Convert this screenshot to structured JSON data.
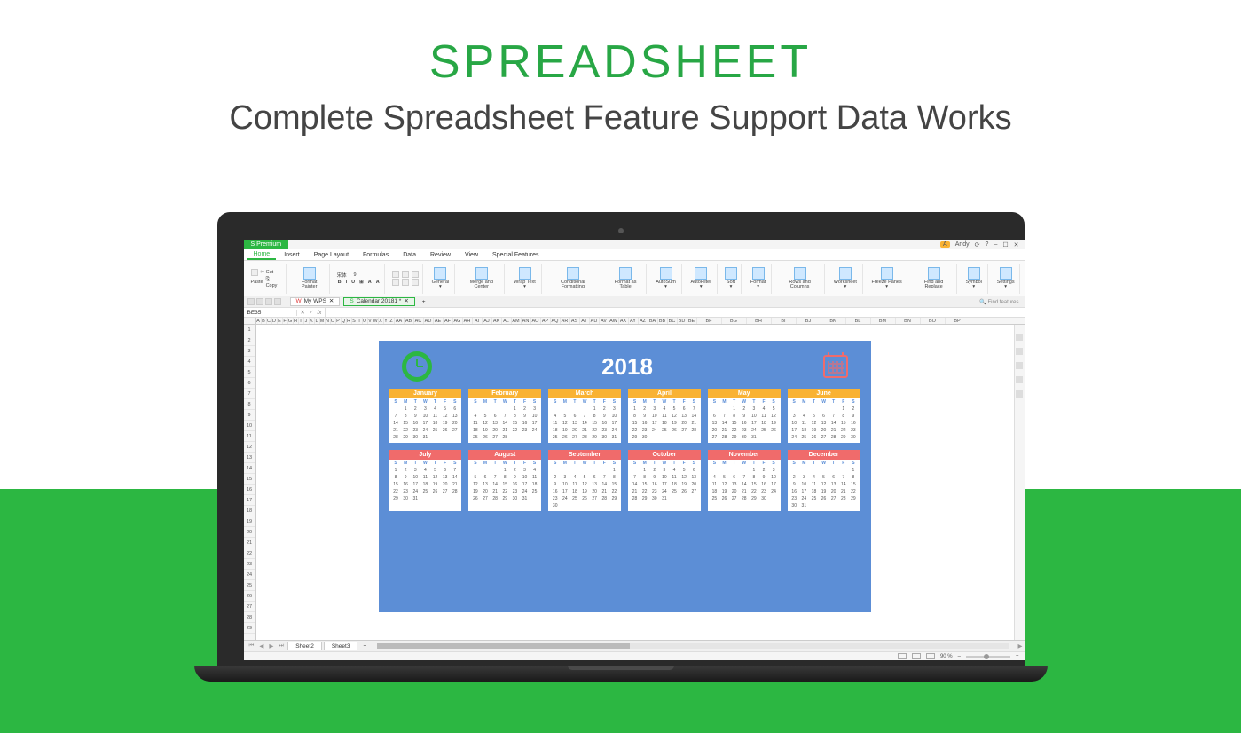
{
  "hero": {
    "title": "SPREADSHEET",
    "subtitle": "Complete Spreadsheet Feature Support Data Works"
  },
  "titlebar": {
    "premium": "S Premium",
    "user": "Andy",
    "icons": [
      "⬌",
      "☐",
      "✕"
    ]
  },
  "menu": {
    "tabs": [
      "Home",
      "Insert",
      "Page Layout",
      "Formulas",
      "Data",
      "Review",
      "View",
      "Special Features"
    ],
    "active": 0
  },
  "ribbon": {
    "clipboard": {
      "paste": "Paste",
      "cut": "✂ Cut",
      "copy": "⎘ Copy",
      "painter": "Format Painter"
    },
    "font": {
      "name": "宋体",
      "size": "9",
      "btns": [
        "B",
        "I",
        "U",
        "⊞",
        "A",
        "A"
      ]
    },
    "number_fmt": "General",
    "groups": [
      "Merge and Center",
      "Wrap Text",
      "Conditional Formatting",
      "Format as Table",
      "AutoSum",
      "AutoFilter",
      "Sort",
      "Format",
      "Rows and Columns",
      "Worksheet",
      "Freeze Panes",
      "Find and Replace",
      "Symbol",
      "Settings"
    ]
  },
  "doctabs": {
    "mywps": "My WPS",
    "active": "Calendar 20181 *"
  },
  "namebox": {
    "cell": "BE35",
    "fx": "fx"
  },
  "find_features": "Find features",
  "columns_narrow": [
    "A",
    "B",
    "C",
    "D",
    "E",
    "F",
    "G",
    "H",
    "I",
    "J",
    "K",
    "L",
    "M",
    "N",
    "O",
    "P",
    "Q",
    "R",
    "S",
    "T",
    "U",
    "V",
    "W",
    "X",
    "Y",
    "Z"
  ],
  "columns_wide": [
    "BF",
    "BG",
    "BH",
    "BI",
    "BJ",
    "BK",
    "BL",
    "BM",
    "BN",
    "BO",
    "BP"
  ],
  "columns_mid": [
    "AA",
    "AB",
    "AC",
    "AD",
    "AE",
    "AF",
    "AG",
    "AH",
    "AI",
    "AJ",
    "AK",
    "AL",
    "AM",
    "AN",
    "AO",
    "AP",
    "AQ",
    "AR",
    "AS",
    "AT",
    "AU",
    "AV",
    "AW",
    "AX",
    "AY",
    "AZ",
    "BA",
    "BB",
    "BC",
    "BD",
    "BE"
  ],
  "row_count": 29,
  "calendar": {
    "year": "2018",
    "dow": [
      "S",
      "M",
      "T",
      "W",
      "T",
      "F",
      "S"
    ],
    "months": [
      {
        "name": "January",
        "color": "y",
        "start": 1,
        "days": 31
      },
      {
        "name": "February",
        "color": "y",
        "start": 4,
        "days": 28
      },
      {
        "name": "March",
        "color": "y",
        "start": 4,
        "days": 31
      },
      {
        "name": "April",
        "color": "y",
        "start": 0,
        "days": 30
      },
      {
        "name": "May",
        "color": "y",
        "start": 2,
        "days": 31
      },
      {
        "name": "June",
        "color": "y",
        "start": 5,
        "days": 30
      },
      {
        "name": "July",
        "color": "r",
        "start": 0,
        "days": 31
      },
      {
        "name": "August",
        "color": "r",
        "start": 3,
        "days": 31
      },
      {
        "name": "September",
        "color": "r",
        "start": 6,
        "days": 30
      },
      {
        "name": "October",
        "color": "r",
        "start": 1,
        "days": 31
      },
      {
        "name": "November",
        "color": "r",
        "start": 4,
        "days": 30
      },
      {
        "name": "December",
        "color": "r",
        "start": 6,
        "days": 31
      }
    ]
  },
  "sheets": {
    "tabs": [
      "Sheet2",
      "Sheet3"
    ],
    "active": 0
  },
  "status": {
    "zoom": "90 %"
  }
}
